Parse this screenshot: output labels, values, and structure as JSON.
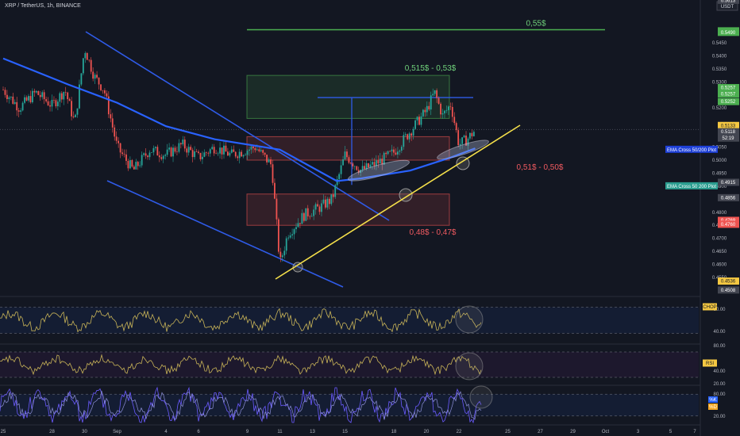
{
  "header": {
    "symbol_line": "XRP / TetherUS, 1h, BINANCE",
    "currency": "USDT"
  },
  "colors": {
    "background": "#131722",
    "candle_up": "#26a69a",
    "candle_down": "#ef5350",
    "ema_line": "#2962ff",
    "channel": "#2f5be8",
    "trendline": "#f5e04a",
    "target": "#4caf50",
    "resistance_zone": "#4caf50",
    "support_zone": "#ef5350",
    "oscillator": "#c9b458",
    "stoch_k": "#6b5bff"
  },
  "chart_data": [
    {
      "type": "line",
      "title": "XRP / TetherUS, 1h, BINANCE",
      "x_tick_labels": [
        "25",
        "28",
        "30",
        "Sep",
        "4",
        "6",
        "9",
        "11",
        "13",
        "15",
        "18",
        "20",
        "22",
        "25",
        "27",
        "29",
        "Oct",
        "3",
        "5",
        "7"
      ],
      "y_tick_labels": [
        "0.5450",
        "0.5400",
        "0.5350",
        "0.5300",
        "0.5200",
        "0.5050",
        "0.5000",
        "0.4950",
        "0.4900",
        "0.4800",
        "0.4750",
        "0.4700",
        "0.4650",
        "0.4600",
        "0.4550"
      ],
      "ylim": [
        0.4475,
        0.5645
      ],
      "price_path": [
        {
          "day": 0,
          "price": 0.527
        },
        {
          "day": 1,
          "price": 0.52
        },
        {
          "day": 2,
          "price": 0.526
        },
        {
          "day": 3,
          "price": 0.521
        },
        {
          "day": 3.8,
          "price": 0.527
        },
        {
          "day": 4.4,
          "price": 0.514
        },
        {
          "day": 5,
          "price": 0.543
        },
        {
          "day": 5.6,
          "price": 0.532
        },
        {
          "day": 6.2,
          "price": 0.527
        },
        {
          "day": 7,
          "price": 0.505
        },
        {
          "day": 8,
          "price": 0.496
        },
        {
          "day": 9,
          "price": 0.504
        },
        {
          "day": 10,
          "price": 0.502
        },
        {
          "day": 11,
          "price": 0.506
        },
        {
          "day": 12,
          "price": 0.501
        },
        {
          "day": 13,
          "price": 0.505
        },
        {
          "day": 14,
          "price": 0.502
        },
        {
          "day": 15.5,
          "price": 0.505
        },
        {
          "day": 16.5,
          "price": 0.498
        },
        {
          "day": 17,
          "price": 0.46
        },
        {
          "day": 17.5,
          "price": 0.472
        },
        {
          "day": 18.5,
          "price": 0.479
        },
        {
          "day": 19.5,
          "price": 0.482
        },
        {
          "day": 20.2,
          "price": 0.485
        },
        {
          "day": 21,
          "price": 0.502
        },
        {
          "day": 22,
          "price": 0.496
        },
        {
          "day": 23,
          "price": 0.499
        },
        {
          "day": 24,
          "price": 0.503
        },
        {
          "day": 25,
          "price": 0.511
        },
        {
          "day": 26,
          "price": 0.519
        },
        {
          "day": 26.5,
          "price": 0.526
        },
        {
          "day": 27,
          "price": 0.517
        },
        {
          "day": 27.5,
          "price": 0.5215
        },
        {
          "day": 28,
          "price": 0.506
        },
        {
          "day": 28.5,
          "price": 0.508
        },
        {
          "day": 29,
          "price": 0.5115
        }
      ],
      "ema_path": [
        {
          "day": 0,
          "price": 0.539
        },
        {
          "day": 4,
          "price": 0.529
        },
        {
          "day": 7,
          "price": 0.522
        },
        {
          "day": 10,
          "price": 0.513
        },
        {
          "day": 13,
          "price": 0.508
        },
        {
          "day": 17,
          "price": 0.504
        },
        {
          "day": 20.5,
          "price": 0.492
        },
        {
          "day": 22,
          "price": 0.493
        },
        {
          "day": 25,
          "price": 0.496
        },
        {
          "day": 27.5,
          "price": 0.501
        },
        {
          "day": 29,
          "price": 0.5045
        }
      ],
      "zones": [
        {
          "label": "0,515$ - 0,53$",
          "top": 0.5325,
          "bottom": 0.516,
          "role": "resistance"
        },
        {
          "label": "0,51$ - 0,50$",
          "top": 0.509,
          "bottom": 0.5,
          "role": "support"
        },
        {
          "label": "0,48$ - 0,47$",
          "top": 0.487,
          "bottom": 0.475,
          "role": "support"
        }
      ],
      "target": {
        "label": "0,55$",
        "price": 0.55
      },
      "price_tags": [
        {
          "text": "0.5613",
          "kind": "neutral"
        },
        {
          "text": "0.5496",
          "kind": "green"
        },
        {
          "text": "0.5490",
          "kind": "green"
        },
        {
          "text": "0.5257",
          "kind": "green"
        },
        {
          "text": "0.5257",
          "kind": "green"
        },
        {
          "text": "0.5252",
          "kind": "green"
        },
        {
          "text": "0.5133",
          "kind": "yellow"
        },
        {
          "text": "0.5118",
          "kind": "neutral"
        },
        {
          "text": "52:19",
          "kind": "neutral"
        },
        {
          "text": "0.4915",
          "kind": "neutral"
        },
        {
          "text": "0.4856",
          "kind": "neutral"
        },
        {
          "text": "0.4769",
          "kind": "red"
        },
        {
          "text": "0.4760",
          "kind": "red"
        },
        {
          "text": "0.4536",
          "kind": "yellow"
        },
        {
          "text": "0.4508",
          "kind": "neutral"
        }
      ],
      "indicator_tags": [
        {
          "text": "EMA Cross 50/200 Plot",
          "kind": "blue"
        },
        {
          "text": "EMA Cross 50 200 Plot",
          "kind": "teal"
        }
      ]
    },
    {
      "type": "line",
      "name": "CHOP",
      "y_tick_labels": [
        "60.00",
        "40.00"
      ],
      "band": [
        38.2,
        61.8
      ]
    },
    {
      "type": "line",
      "name": "RSI",
      "y_tick_labels": [
        "80.00",
        "40.00",
        "20.00"
      ],
      "band": [
        30,
        70
      ]
    },
    {
      "type": "line",
      "name": "Stoch",
      "y_tick_labels": [
        "80.00",
        "20.00"
      ],
      "band": [
        20,
        80
      ],
      "legend": [
        "%K",
        "%D"
      ]
    }
  ]
}
